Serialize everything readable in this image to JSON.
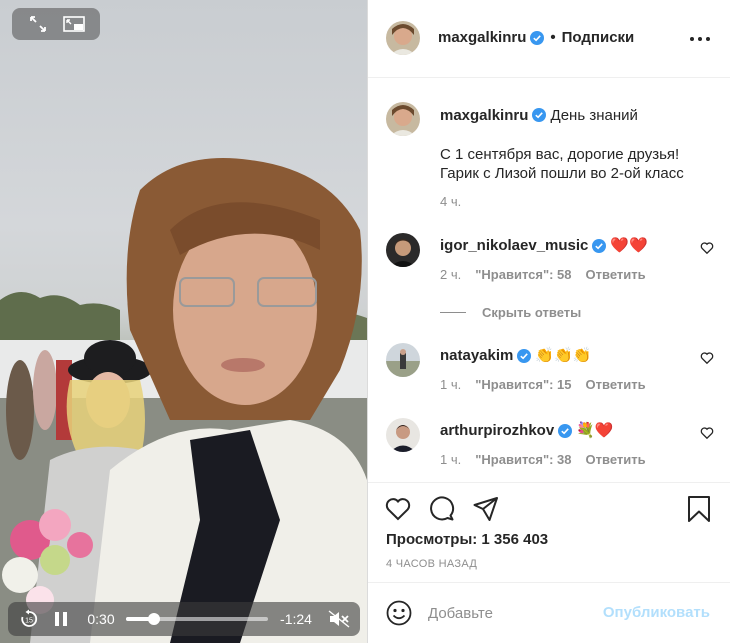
{
  "video": {
    "current_time": "0:30",
    "remaining_time": "-1:24",
    "progress": 0.2,
    "icons": {
      "expand": "expand-icon",
      "pip": "picture-in-picture-icon",
      "rewind": "rewind-15-icon",
      "pause": "pause-icon",
      "mute": "muted-speaker-icon"
    }
  },
  "header": {
    "username": "maxgalkinru",
    "separator": "•",
    "follow_label": "Подписки"
  },
  "caption": {
    "username": "maxgalkinru",
    "title": "День знаний",
    "body_line1": "С 1 сентября вас, дорогие друзья!",
    "body_line2": "Гарик с Лизой пошли во 2-ой класс",
    "time": "4 ч."
  },
  "comments": [
    {
      "username": "igor_nikolaev_music",
      "verified": true,
      "text": "❤️❤️",
      "time": "2 ч.",
      "likes": "\"Нравится\": 58",
      "reply": "Ответить"
    },
    {
      "username": "natayakim",
      "verified": true,
      "text": "👏👏👏",
      "time": "1 ч.",
      "likes": "\"Нравится\": 15",
      "reply": "Ответить"
    },
    {
      "username": "arthurpirozhkov",
      "verified": true,
      "text": "💐❤️",
      "time": "1 ч.",
      "likes": "\"Нравится\": 38",
      "reply": "Ответить"
    }
  ],
  "hide_replies": "Скрыть ответы",
  "stats": {
    "views": "Просмотры: 1 356 403",
    "posted": "4 ЧАСОВ НАЗАД"
  },
  "compose": {
    "placeholder": "Добавьте",
    "publish": "Опубликовать"
  },
  "colors": {
    "verified": "#3897f0",
    "muted": "#8e8e8e",
    "publish_disabled": "#b2dffc",
    "text": "#262626"
  }
}
